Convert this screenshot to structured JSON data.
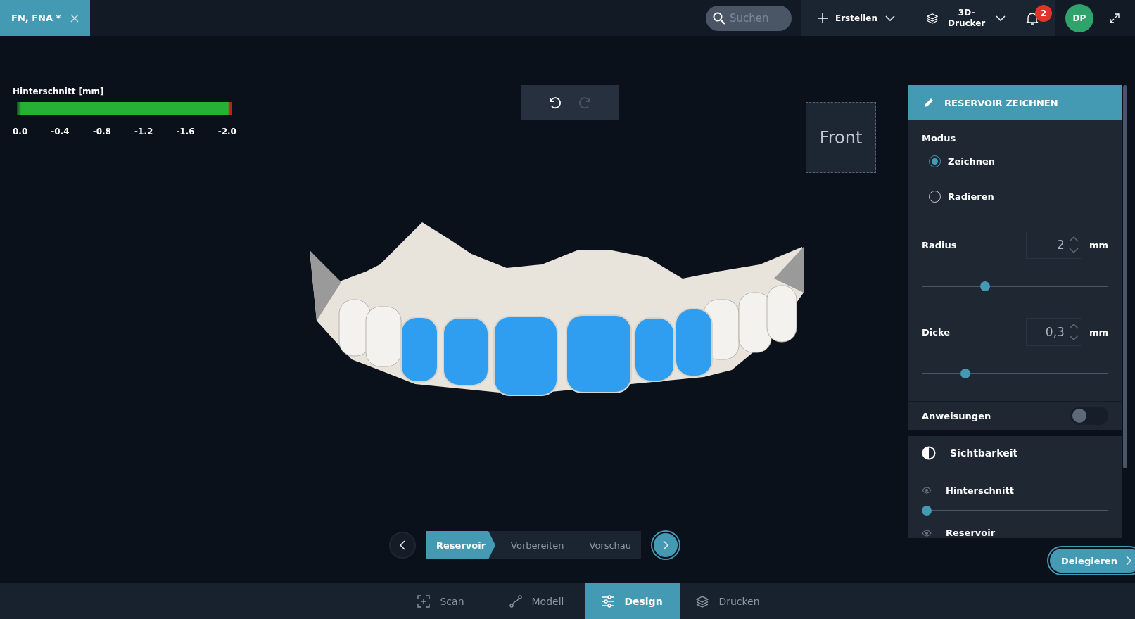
{
  "tab": {
    "title": "FN, FNA *"
  },
  "search": {
    "placeholder": "Suchen"
  },
  "create_menu": {
    "label": "Erstellen"
  },
  "printer_menu": {
    "label": "3D-Drucker"
  },
  "notifications": {
    "count": "2"
  },
  "avatar": {
    "initials": "DP"
  },
  "legend": {
    "title": "Hinterschnitt [mm]",
    "ticks": [
      "0.0",
      "-0.4",
      "-0.8",
      "-1.2",
      "-1.6",
      "-2.0"
    ]
  },
  "history": [
    {
      "kind": "undo",
      "disabled": false
    },
    {
      "kind": "redo",
      "disabled": true
    }
  ],
  "view_cube": {
    "label": "Front"
  },
  "panel": {
    "title": "RESERVOIR ZEICHNEN",
    "mode_label": "Modus",
    "modes": [
      {
        "label": "Zeichnen",
        "selected": true
      },
      {
        "label": "Radieren",
        "selected": false
      }
    ],
    "params": [
      {
        "label": "Radius",
        "value": "2",
        "unit": "mm",
        "level": 0.34
      },
      {
        "label": "Dicke",
        "value": "0,3",
        "unit": "mm",
        "level": 0.235
      }
    ],
    "instructions": {
      "label": "Anweisungen",
      "on": false
    },
    "visibility": {
      "title": "Sichtbarkeit",
      "items": [
        {
          "label": "Hinterschnitt",
          "level": 0
        },
        {
          "label": "Reservoir"
        }
      ]
    }
  },
  "steps": [
    {
      "label": "Reservoir",
      "selected": true
    },
    {
      "label": "Vorbereiten",
      "selected": false
    },
    {
      "label": "Vorschau",
      "selected": false
    }
  ],
  "delegate_button": {
    "label": "Delegieren"
  },
  "bottom_tabs": [
    {
      "label": "Scan",
      "kind": "scan",
      "selected": false
    },
    {
      "label": "Modell",
      "kind": "model",
      "selected": false
    },
    {
      "label": "Design",
      "kind": "design",
      "selected": true
    },
    {
      "label": "Drucken",
      "kind": "print",
      "selected": false
    }
  ]
}
